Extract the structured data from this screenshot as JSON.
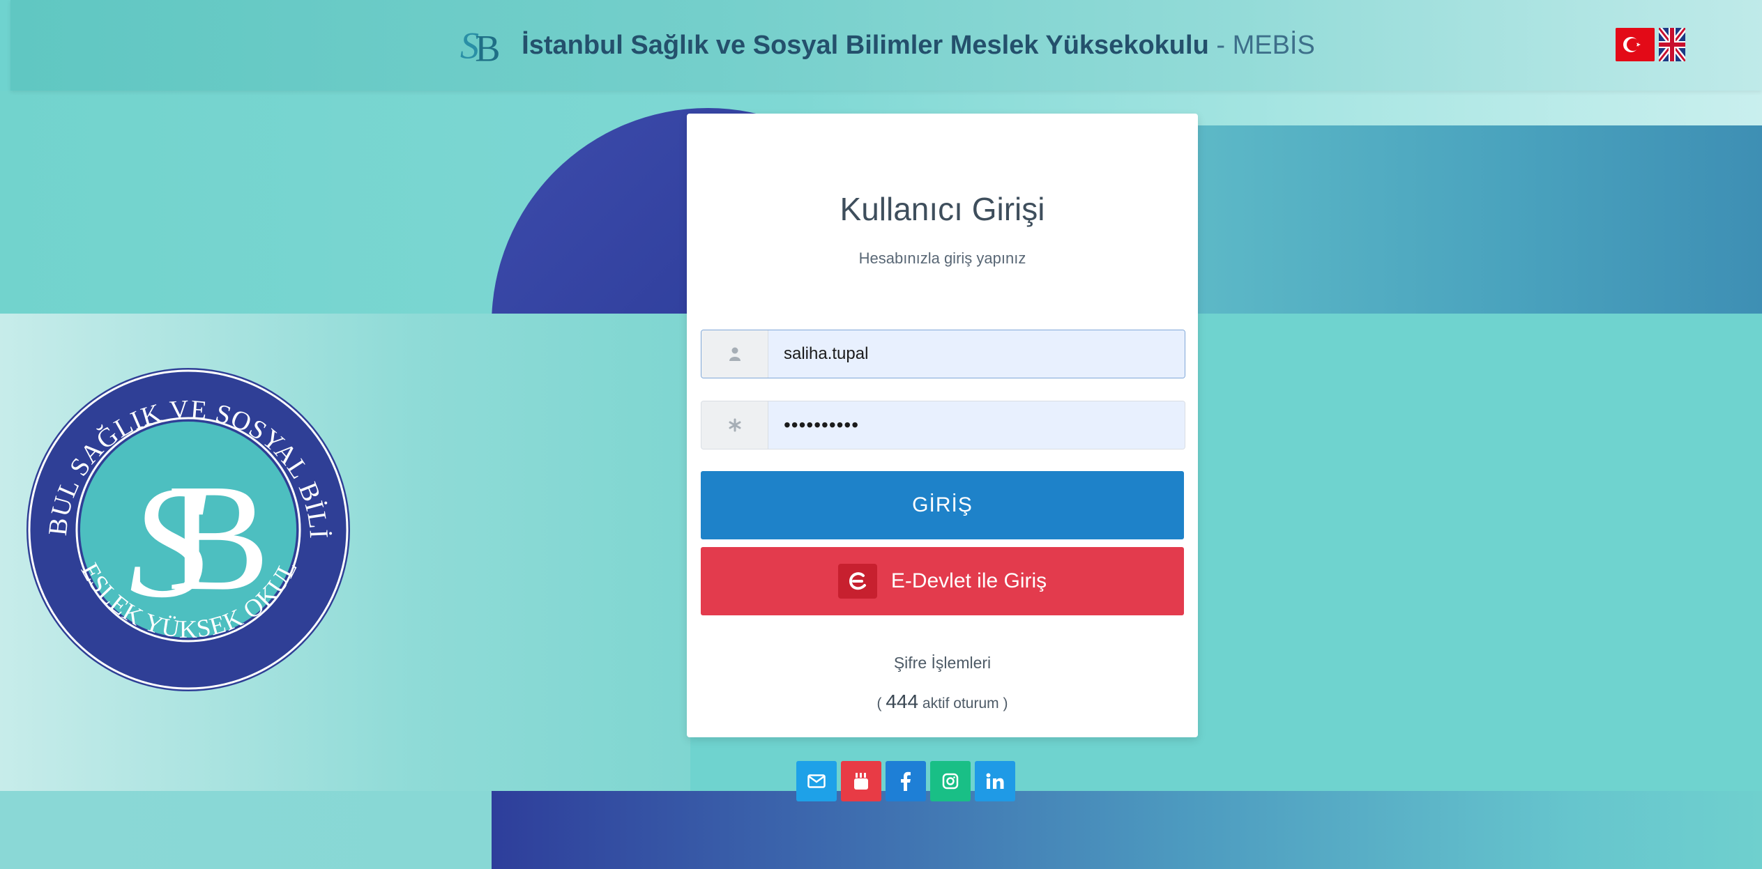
{
  "header": {
    "title_bold": "İstanbul Sağlık ve Sosyal Bilimler Meslek Yüksekokulu",
    "title_separator": " - ",
    "title_light": "MEBİS",
    "logo_text": "SB",
    "languages": [
      "tr",
      "en"
    ]
  },
  "seal": {
    "top_text": "İSTANBUL SAĞLIK VE SOSYAL BİLİMLER",
    "bottom_text": "MESLEK YÜKSEK OKULU",
    "monogram": "SB"
  },
  "login": {
    "title": "Kullanıcı Girişi",
    "subtitle": "Hesabınızla giriş yapınız",
    "username_value": "saliha.tupal",
    "password_value": "••••••••••",
    "login_button": "GİRİŞ",
    "edevlet_button": "E-Devlet ile Giriş",
    "password_link": "Şifre İşlemleri",
    "sessions_prefix": "( ",
    "sessions_count": "444",
    "sessions_suffix": " aktif oturum )"
  },
  "social": {
    "items": [
      "mail-icon",
      "youtube-icon",
      "facebook-icon",
      "instagram-icon",
      "linkedin-icon"
    ]
  },
  "colors": {
    "primary_button": "#1e82c9",
    "edevlet_button": "#e33b4d",
    "navy": "#2e3e9b",
    "teal": "#6fd3cf"
  }
}
